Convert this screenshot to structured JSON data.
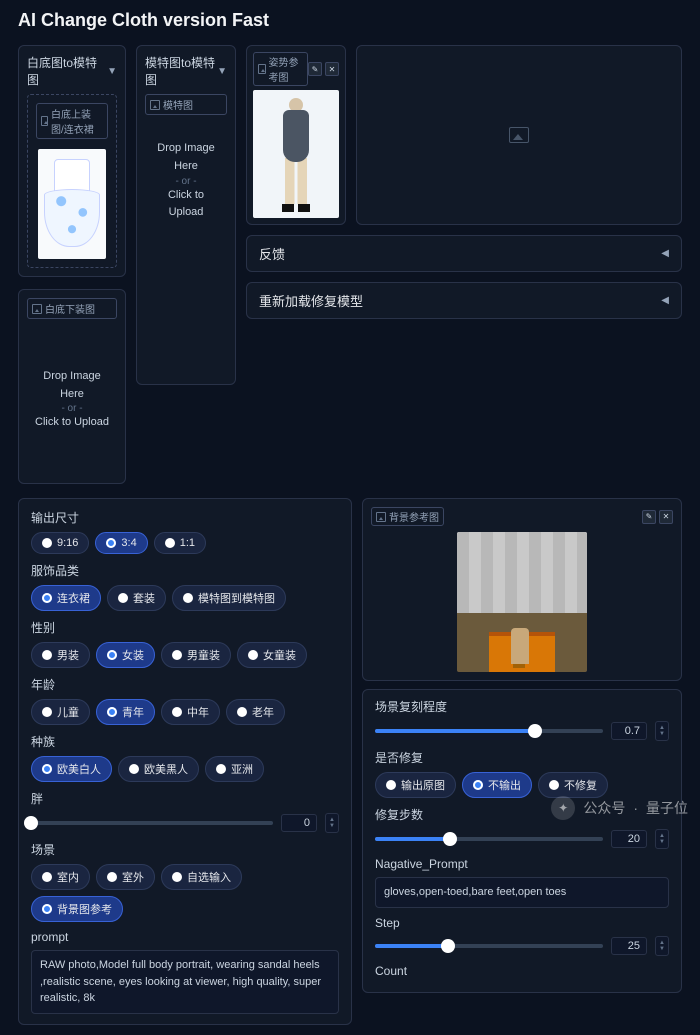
{
  "title": "AI Change Cloth version Fast",
  "uploads": {
    "col1_header": "白底图to模特图",
    "top_label": "白底上装图/连衣裙",
    "bottom_label": "白底下装图",
    "col2_header": "模特图to模特图",
    "model_label": "模特图",
    "drop_here": "Drop Image Here",
    "or": "- or -",
    "click": "Click to Upload"
  },
  "pose": {
    "label": "姿势参考图",
    "edit": "✎",
    "close": "✕"
  },
  "accordions": {
    "feedback": "反馈",
    "reload": "重新加载修复模型",
    "arrow": "◀"
  },
  "left": {
    "out_size": {
      "label": "输出尺寸",
      "opts": [
        "9:16",
        "3:4",
        "1:1"
      ],
      "sel": 1
    },
    "category": {
      "label": "服饰品类",
      "opts": [
        "连衣裙",
        "套装",
        "模特图到模特图"
      ],
      "sel": 0
    },
    "gender": {
      "label": "性别",
      "opts": [
        "男装",
        "女装",
        "男童装",
        "女童装"
      ],
      "sel": 1
    },
    "age": {
      "label": "年龄",
      "opts": [
        "儿童",
        "青年",
        "中年",
        "老年"
      ],
      "sel": 1
    },
    "race": {
      "label": "种族",
      "opts": [
        "欧美白人",
        "欧美黑人",
        "亚洲"
      ],
      "sel": 0
    },
    "fat": {
      "label": "胖",
      "value": 0,
      "pct": 0
    },
    "scene": {
      "label": "场景",
      "opts": [
        "室内",
        "室外",
        "自选输入",
        "背景图参考"
      ],
      "sel": 3
    },
    "prompt_label": "prompt",
    "prompt_value": "RAW photo,Model full body portrait, wearing sandal heels ,realistic scene, eyes looking at viewer, high quality, super realistic, 8k"
  },
  "right": {
    "bg_label": "背景参考图",
    "bg_edit": "✎",
    "bg_close": "✕",
    "scene_copy": {
      "label": "场景复刻程度",
      "value": 0.7,
      "pct": 70
    },
    "repair_opt": {
      "label": "是否修复",
      "opts": [
        "输出原图",
        "不输出",
        "不修复"
      ],
      "sel": 1
    },
    "repair_steps": {
      "label": "修复步数",
      "value": 20,
      "pct": 33
    },
    "neg_label": "Nagative_Prompt",
    "neg_value": "gloves,open-toed,bare feet,open toes",
    "step": {
      "label": "Step",
      "value": 25,
      "pct": 32
    },
    "count": {
      "label": "Count"
    }
  },
  "watermark": {
    "prefix": "公众号",
    "dot": "·",
    "name": "量子位"
  }
}
